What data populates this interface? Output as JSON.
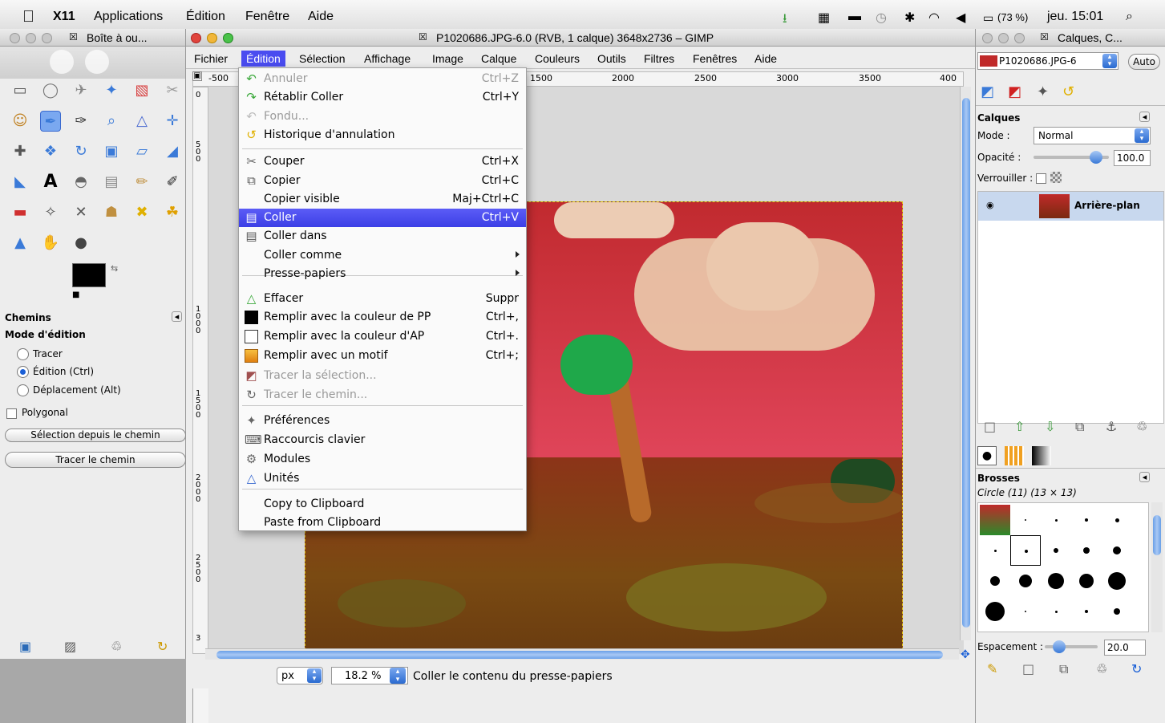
{
  "menubar": {
    "app": "X11",
    "items": [
      "Applications",
      "Édition",
      "Fenêtre",
      "Aide"
    ],
    "battery": "(73 %)",
    "clock": "jeu. 15:01"
  },
  "toolbox": {
    "title": "Boîte à ou...",
    "section": "Chemins",
    "mode_label": "Mode d'édition",
    "modes": [
      "Tracer",
      "Édition (Ctrl)",
      "Déplacement (Alt)"
    ],
    "polygonal": "Polygonal",
    "btn_selection": "Sélection depuis le chemin",
    "btn_trace": "Tracer le chemin"
  },
  "window": {
    "title": "P1020686.JPG-6.0 (RVB, 1 calque) 3648x2736 – GIMP",
    "menus": [
      "Fichier",
      "Édition",
      "Sélection",
      "Affichage",
      "Image",
      "Calque",
      "Couleurs",
      "Outils",
      "Filtres",
      "Fenêtres",
      "Aide"
    ],
    "ruler_labels": [
      "-500",
      "1500",
      "2000",
      "2500",
      "3000",
      "3500",
      "400"
    ],
    "vruler_labels": [
      "0",
      "5\n0\n0",
      "1\n0\n0\n0",
      "1\n5\n0\n0",
      "2\n0\n0\n0",
      "2\n5\n0\n0",
      "3"
    ],
    "unit": "px",
    "zoom": "18.2 %",
    "status": "Coller le contenu du presse-papiers"
  },
  "edit_menu": {
    "items": [
      {
        "label": "Annuler",
        "shortcut": "Ctrl+Z",
        "disabled": true
      },
      {
        "label": "Rétablir Coller",
        "shortcut": "Ctrl+Y"
      },
      {
        "label": "Fondu...",
        "shortcut": "",
        "disabled": true
      },
      {
        "label": "Historique d'annulation",
        "shortcut": ""
      },
      {
        "label": "Couper",
        "shortcut": "Ctrl+X"
      },
      {
        "label": "Copier",
        "shortcut": "Ctrl+C"
      },
      {
        "label": "Copier visible",
        "shortcut": "Maj+Ctrl+C"
      },
      {
        "label": "Coller",
        "shortcut": "Ctrl+V",
        "selected": true
      },
      {
        "label": "Coller dans",
        "shortcut": ""
      },
      {
        "label": "Coller comme",
        "shortcut": ""
      },
      {
        "label": "Presse-papiers",
        "shortcut": ""
      },
      {
        "label": "Effacer",
        "shortcut": "Suppr"
      },
      {
        "label": "Remplir avec la couleur de PP",
        "shortcut": "Ctrl+,"
      },
      {
        "label": "Remplir avec la couleur d'AP",
        "shortcut": "Ctrl+."
      },
      {
        "label": "Remplir avec un motif",
        "shortcut": "Ctrl+;"
      },
      {
        "label": "Tracer la sélection...",
        "shortcut": "",
        "disabled": true
      },
      {
        "label": "Tracer le chemin...",
        "shortcut": "",
        "disabled": true
      },
      {
        "label": "Préférences",
        "shortcut": ""
      },
      {
        "label": "Raccourcis clavier",
        "shortcut": ""
      },
      {
        "label": "Modules",
        "shortcut": ""
      },
      {
        "label": "Unités",
        "shortcut": ""
      },
      {
        "label": "Copy to Clipboard",
        "shortcut": ""
      },
      {
        "label": "Paste from Clipboard",
        "shortcut": ""
      }
    ]
  },
  "dock": {
    "title": "Calques, C...",
    "image_select": "P1020686.JPG-6",
    "auto": "Auto",
    "layers_title": "Calques",
    "mode_label": "Mode :",
    "mode_value": "Normal",
    "opacity_label": "Opacité :",
    "opacity": "100.0",
    "lock_label": "Verrouiller :",
    "layer_name": "Arrière-plan",
    "brushes_title": "Brosses",
    "brush_name": "Circle (11) (13 × 13)",
    "spacing_label": "Espacement :",
    "spacing": "20.0"
  },
  "colors": {
    "menu_selected": "#4a4cf0",
    "canvas_bg": "#d9d9d9",
    "selection_border": "#e0c000"
  }
}
